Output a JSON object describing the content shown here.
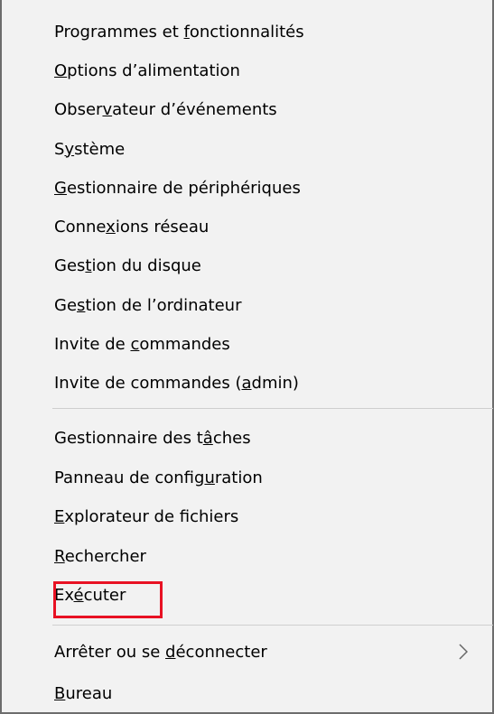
{
  "menu": {
    "group1": [
      {
        "pre": "Programmes et ",
        "key": "f",
        "post": "onctionnalités"
      },
      {
        "pre": "",
        "key": "O",
        "post": "ptions d’alimentation"
      },
      {
        "pre": "Obser",
        "key": "v",
        "post": "ateur d’événements"
      },
      {
        "pre": "S",
        "key": "y",
        "post": "stème"
      },
      {
        "pre": "",
        "key": "G",
        "post": "estionnaire de périphériques"
      },
      {
        "pre": "Conne",
        "key": "x",
        "post": "ions réseau"
      },
      {
        "pre": "Ges",
        "key": "t",
        "post": "ion du disque"
      },
      {
        "pre": "Ge",
        "key": "s",
        "post": "tion de l’ordinateur"
      },
      {
        "pre": "Invite de ",
        "key": "c",
        "post": "ommandes"
      },
      {
        "pre": "Invite de commandes (",
        "key": "a",
        "post": "dmin)"
      }
    ],
    "group2": [
      {
        "pre": "Gestionnaire des t",
        "key": "â",
        "post": "ches"
      },
      {
        "pre": "Panneau de config",
        "key": "u",
        "post": "ration"
      },
      {
        "pre": "",
        "key": "E",
        "post": "xplorateur de fichiers"
      },
      {
        "pre": "",
        "key": "R",
        "post": "echercher"
      },
      {
        "pre": "Ex",
        "key": "é",
        "post": "cuter"
      }
    ],
    "group3": [
      {
        "pre": "Arrêter ou se ",
        "key": "d",
        "post": "éconnecter"
      },
      {
        "pre": "",
        "key": "B",
        "post": "ureau"
      }
    ],
    "submenu_icon": "chevron-right-icon",
    "highlight_color": "#e81123"
  }
}
